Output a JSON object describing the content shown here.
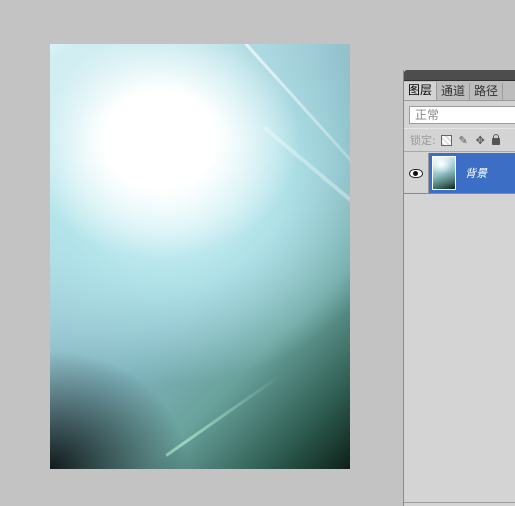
{
  "layers_panel": {
    "tabs": [
      {
        "label": "图层",
        "active": true
      },
      {
        "label": "通道",
        "active": false
      },
      {
        "label": "路径",
        "active": false
      }
    ],
    "blend_mode": "正常",
    "lock_label": "锁定:",
    "layers": [
      {
        "name": "背景",
        "visible": true,
        "selected": true
      }
    ]
  },
  "colors": {
    "workspace_bg": "#c3c3c3",
    "panel_bg": "#d4d4d4",
    "selection_blue": "#3c6ec6"
  }
}
